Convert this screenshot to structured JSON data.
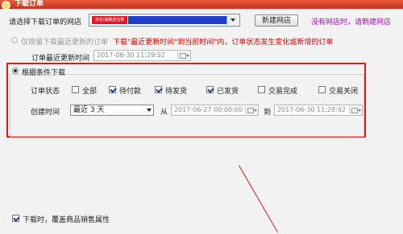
{
  "window": {
    "title": "下载订单"
  },
  "shop": {
    "label": "请选择下载订单的网店",
    "selected_chip": "淘宝/旗舰店名称",
    "new_shop_button": "新建网店",
    "no_shop_link": "没有网店时，请新建网店"
  },
  "incremental": {
    "radio_label": "仅增量下载最近更新的订单",
    "note": "下载\"最近更新时间\"到当前时间\"内，订单状态发生变化或新增的订单",
    "last_update_label": "订单最近更新时间",
    "last_update_value": "2017-06-30 11:29:52"
  },
  "conditional": {
    "radio_label": "根据条件下载",
    "status_label": "订单状态",
    "statuses": [
      {
        "label": "全部",
        "checked": false
      },
      {
        "label": "待付款",
        "checked": true
      },
      {
        "label": "待发货",
        "checked": true
      },
      {
        "label": "已发货",
        "checked": true
      },
      {
        "label": "交易完成",
        "checked": false
      },
      {
        "label": "交易关闭",
        "checked": false
      }
    ],
    "created_label": "创建时间",
    "range_value": "最近 3 天",
    "from_label": "从",
    "from_value": "2017-06-27 00:00:00",
    "to_label": "到",
    "to_value": "2017-06-30 11:28:42"
  },
  "overwrite": {
    "label": "下载时，覆盖商品销售属性",
    "checked": true
  },
  "colors": {
    "highlight": "#e3181f",
    "link": "#b000c8",
    "note": "#d40000",
    "title_bar": "#d8462a"
  }
}
